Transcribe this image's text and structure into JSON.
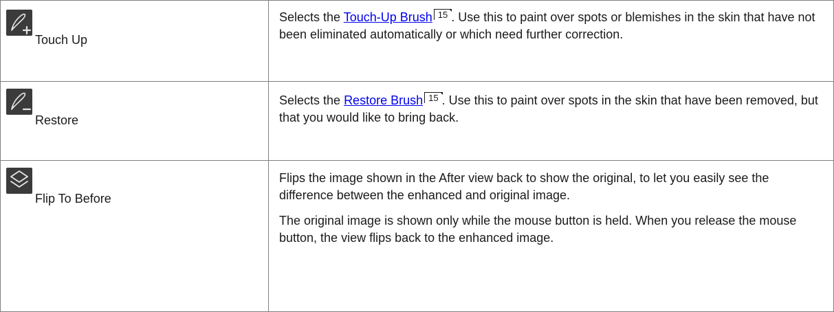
{
  "rows": [
    {
      "tool": {
        "icon": "touch-up-brush-icon",
        "label": "Touch Up"
      },
      "description": {
        "before_link": "Selects the ",
        "link_text": "Touch-Up Brush",
        "page_ref": "15",
        "after_link": ". Use this to paint over spots or blemishes in the skin that have not been eliminated automatically or which need further correction."
      }
    },
    {
      "tool": {
        "icon": "restore-brush-icon",
        "label": "Restore"
      },
      "description": {
        "before_link": "Selects the ",
        "link_text": "Restore Brush",
        "page_ref": "15",
        "after_link": ". Use this to paint over spots in the skin that have been removed, but that you would like to bring back."
      }
    },
    {
      "tool": {
        "icon": "layers-flip-icon",
        "label": "Flip To Before"
      },
      "description": {
        "paragraph_1": "Flips the image shown in the After view back to show the original, to let you easily see the difference between the enhanced and original image.",
        "paragraph_2": "The original image is shown only while the mouse button is held. When you release the mouse button, the view flips back to the enhanced image."
      }
    }
  ],
  "colors": {
    "icon_background": "#3b3b3b",
    "icon_foreground": "#e6e6e6",
    "link": "#0000ee",
    "border": "#7f7f7f"
  }
}
